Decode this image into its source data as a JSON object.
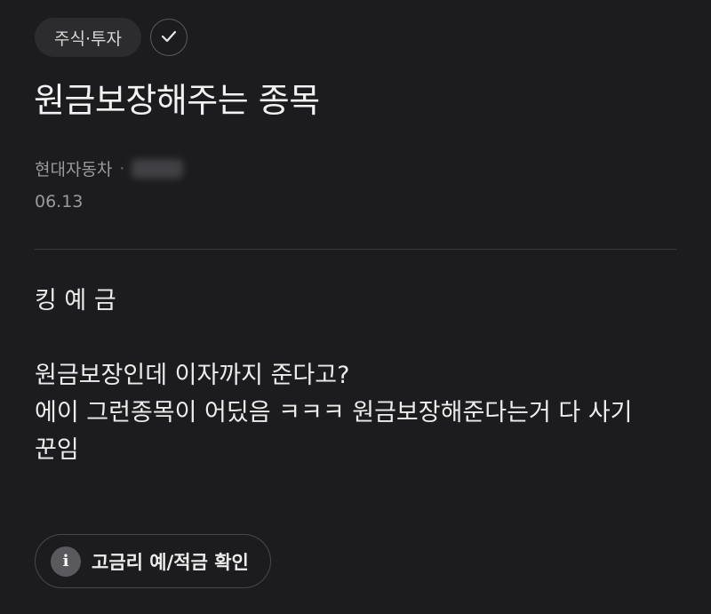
{
  "header": {
    "category": "주식·투자",
    "check_icon": "check-icon"
  },
  "post": {
    "title": "원금보장해주는 종목",
    "author_group": "현대자동차",
    "separator": "·",
    "date": "06.13",
    "body": {
      "line1": "킹 예 금",
      "line2": "원금보장인데 이자까지 준다고?",
      "line3": "에이 그런종목이 어딨음 ㅋㅋㅋ 원금보장해준다는거 다 사기",
      "line4": "꾼임"
    }
  },
  "footer": {
    "info_icon": "info-icon",
    "info_icon_glyph": "i",
    "button_label": "고금리 예/적금 확인"
  },
  "colors": {
    "background": "#1c1c1e",
    "pill": "#2c2c2e",
    "text_primary": "#ececec",
    "text_secondary": "#9a9a9e"
  }
}
